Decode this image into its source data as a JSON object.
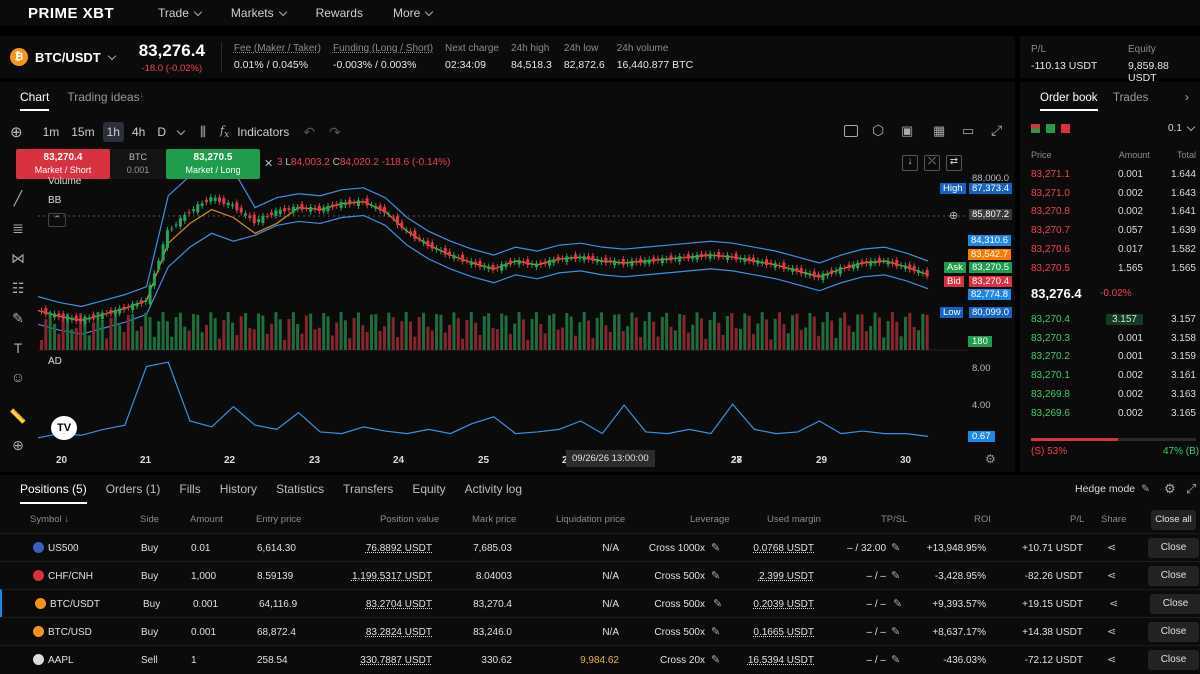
{
  "nav": {
    "logo": "PRIME XBT",
    "items": [
      "Trade",
      "Markets",
      "Rewards",
      "More"
    ]
  },
  "ticker": {
    "symbol": "BTC/USDT",
    "price": "83,276.4",
    "change": "-18.0 (-0.02%)",
    "stats": [
      {
        "label": "Fee (Maker / Taker)",
        "value": "0.01% / 0.045%"
      },
      {
        "label": "Funding (Long / Short)",
        "value": "-0.003% / 0.003%"
      },
      {
        "label": "Next charge",
        "value": "02:34:09"
      },
      {
        "label": "24h high",
        "value": "84,518.3"
      },
      {
        "label": "24h low",
        "value": "82,872.6"
      },
      {
        "label": "24h volume",
        "value": "16,440.877 BTC"
      }
    ]
  },
  "account": {
    "pl_label": "P/L",
    "pl_value": "-110.13 USDT",
    "equity_label": "Equity",
    "equity_value": "9,859.88 USDT"
  },
  "chart_tabs": [
    "Chart",
    "Trading ideas"
  ],
  "toolbar": {
    "intervals": [
      "1m",
      "15m",
      "1h",
      "4h",
      "D"
    ],
    "indicators": "Indicators"
  },
  "quick_trade": {
    "short_price": "83,270.4",
    "short_label": "Market / Short",
    "asset": "BTC",
    "amount": "0.001",
    "long_price": "83,270.5",
    "long_label": "Market / Long"
  },
  "ohlc": {
    "prefix": "3",
    "low": "84,003.2",
    "close": "84,020.2",
    "change": "-118.6 (-0.14%)"
  },
  "chart": {
    "legend_volume": "Volume",
    "legend_bb": "BB",
    "legend_ad": "AD",
    "tv_logo": "TV",
    "crosshair_date": "09/26/26   13:00:00",
    "date_labels": [
      "20",
      "21",
      "22",
      "23",
      "24",
      "25",
      "2",
      "27",
      "28",
      "29",
      "30"
    ]
  },
  "axis": {
    "p88000": "88,000.0",
    "high_label": "High",
    "high_value": "87,373.4",
    "crosshair": "85,807.2",
    "bb_upper": "84,310.6",
    "bb_basis": "83,542.7",
    "ask_label": "Ask",
    "ask_value": "83,270.5",
    "bid_label": "Bid",
    "bid_value": "83,270.4",
    "bb_lower": "82,774.8",
    "low_label": "Low",
    "low_value": "80,099.0",
    "volume": "180",
    "ad_8": "8.00",
    "ad_4": "4.00",
    "ad_value": "0.67"
  },
  "chart_data": {
    "type": "candlestick",
    "x_labels": [
      "20",
      "21",
      "22",
      "23",
      "24",
      "25",
      "26",
      "27",
      "28",
      "29",
      "30"
    ],
    "price_range": [
      79500,
      88500
    ],
    "high": 87373.4,
    "low": 80099.0,
    "close_series": [
      81500,
      81200,
      81000,
      81300,
      81600,
      82000,
      85500,
      86500,
      87200,
      86800,
      86000,
      86500,
      86700,
      86600,
      86900,
      87000,
      86500,
      85500,
      84800,
      84300,
      83900,
      83600,
      84000,
      83800,
      84100,
      84200,
      84000,
      83900,
      84000,
      84100,
      84200,
      84300,
      84200,
      84000,
      83800,
      83500,
      83200,
      83600,
      83900,
      84000,
      83700,
      83300
    ],
    "ad_series": [
      0.5,
      1.0,
      0.8,
      1.5,
      2.0,
      9.0,
      9.5,
      2.5,
      1.8,
      4.2,
      2.0,
      1.5,
      3.5,
      1.2,
      1.0,
      1.8,
      1.3,
      1.0,
      1.5,
      1.0,
      2.2,
      3.0,
      1.0,
      1.2,
      1.5,
      2.5,
      1.0,
      4.4,
      1.2,
      1.0,
      1.5,
      1.0,
      4.5,
      1.5,
      1.0,
      1.2,
      2.5,
      1.0,
      1.3,
      1.0,
      1.0,
      0.67
    ],
    "ad_range": [
      0,
      10
    ]
  },
  "orderbook": {
    "tabs": [
      "Order book",
      "Trades"
    ],
    "tick_size": "0.1",
    "headers": [
      "Price",
      "Amount",
      "Total"
    ],
    "asks": [
      [
        "83,271.1",
        "0.001",
        "1.644"
      ],
      [
        "83,271.0",
        "0.002",
        "1.643"
      ],
      [
        "83,270.8",
        "0.002",
        "1.641"
      ],
      [
        "83,270.7",
        "0.057",
        "1.639"
      ],
      [
        "83,270.6",
        "0.017",
        "1.582"
      ],
      [
        "83,270.5",
        "1.565",
        "1.565"
      ]
    ],
    "mid_price": "83,276.4",
    "mid_change": "-0.02%",
    "bids": [
      [
        "83,270.4",
        "3.157",
        "3.157"
      ],
      [
        "83,270.3",
        "0.001",
        "3.158"
      ],
      [
        "83,270.2",
        "0.001",
        "3.159"
      ],
      [
        "83,270.1",
        "0.002",
        "3.161"
      ],
      [
        "83,269.8",
        "0.002",
        "3.163"
      ],
      [
        "83,269.6",
        "0.002",
        "3.165"
      ]
    ],
    "sentiment_sell_pct": 53,
    "sentiment_sell": "(S) 53%",
    "sentiment_buy": "47% (B)"
  },
  "positions": {
    "tabs": [
      "Positions (5)",
      "Orders (1)",
      "Fills",
      "History",
      "Statistics",
      "Transfers",
      "Equity",
      "Activity log"
    ],
    "hedge_mode": "Hedge mode",
    "close_all": "Close all",
    "headers": [
      "Symbol",
      "Side",
      "Amount",
      "Entry price",
      "Position value",
      "Mark price",
      "Liquidation price",
      "Leverage",
      "Used margin",
      "TP/SL",
      "ROI",
      "P/L",
      "Share"
    ],
    "rows": [
      {
        "symbol": "US500",
        "flag_color": "#3b5fbf",
        "side": "Buy",
        "amount": "0.01",
        "entry": "6,614.30",
        "value": "76.8892 USDT",
        "mark": "7,685.03",
        "liq": "N/A",
        "leverage": "Cross 1000x",
        "margin": "0.0768 USDT",
        "tpsl": "– / 32.00",
        "roi": "+13,948.95%",
        "pl": "+10.71 USDT",
        "close": "Close"
      },
      {
        "symbol": "CHF/CNH",
        "flag_color": "#d8313f",
        "side": "Buy",
        "amount": "1,000",
        "entry": "8.59139",
        "value": "1,199.5317 USDT",
        "mark": "8.04003",
        "liq": "N/A",
        "leverage": "Cross 500x",
        "margin": "2.399 USDT",
        "tpsl": "– / –",
        "roi": "-3,428.95%",
        "pl": "-82.26 USDT",
        "close": "Close"
      },
      {
        "symbol": "BTC/USDT",
        "flag_color": "#f7931a",
        "side": "Buy",
        "amount": "0.001",
        "entry": "64,116.9",
        "value": "83.2704 USDT",
        "mark": "83,270.4",
        "liq": "N/A",
        "leverage": "Cross 500x",
        "margin": "0.2039 USDT",
        "tpsl": "– / –",
        "roi": "+9,393.57%",
        "pl": "+19.15 USDT",
        "close": "Close"
      },
      {
        "symbol": "BTC/USD",
        "flag_color": "#f7931a",
        "side": "Buy",
        "amount": "0.001",
        "entry": "68,872.4",
        "value": "83.2824 USDT",
        "mark": "83,246.0",
        "liq": "N/A",
        "leverage": "Cross 500x",
        "margin": "0.1665 USDT",
        "tpsl": "– / –",
        "roi": "+8,637.17%",
        "pl": "+14.38 USDT",
        "close": "Close"
      },
      {
        "symbol": "AAPL",
        "flag_color": "#dddddd",
        "side": "Sell",
        "amount": "1",
        "entry": "258.54",
        "value": "330.7887 USDT",
        "mark": "330.62",
        "liq": "9,984.62",
        "leverage": "Cross 20x",
        "margin": "16.5394 USDT",
        "tpsl": "– / –",
        "roi": "-436.03%",
        "pl": "-72.12 USDT",
        "close": "Close"
      }
    ]
  }
}
